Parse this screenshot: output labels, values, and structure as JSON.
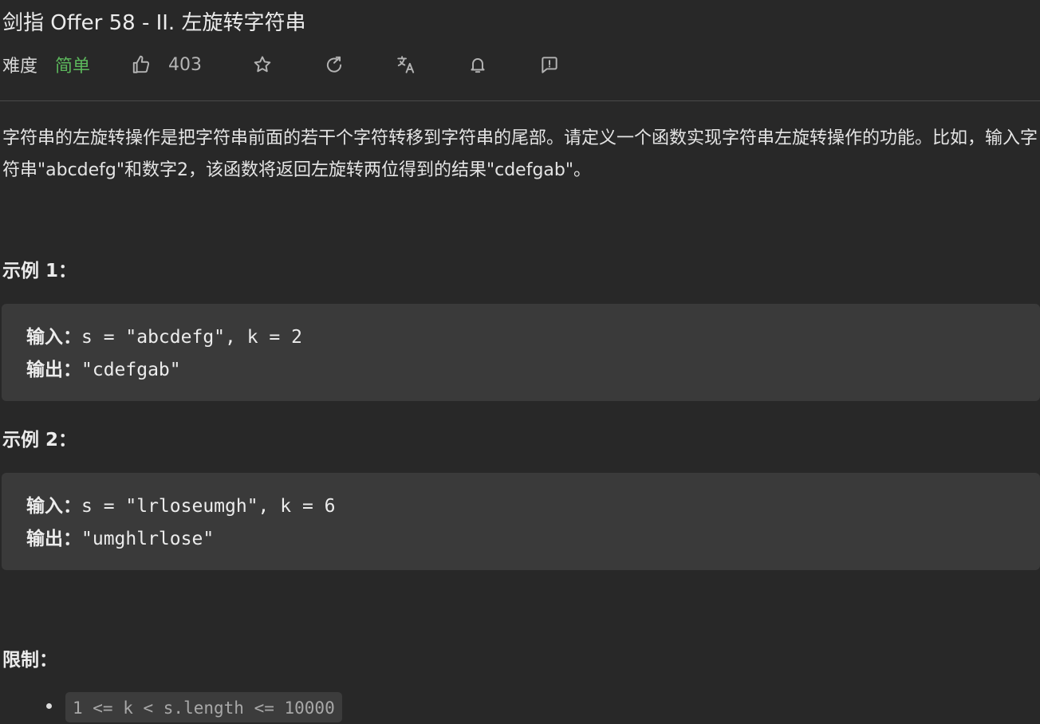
{
  "problem": {
    "title": "剑指 Offer 58 - II. 左旋转字符串",
    "difficulty_label": "难度",
    "difficulty": "简单",
    "likes": "403",
    "description": "字符串的左旋转操作是把字符串前面的若干个字符转移到字符串的尾部。请定义一个函数实现字符串左旋转操作的功能。比如，输入字符串\"abcdefg\"和数字2，该函数将返回左旋转两位得到的结果\"cdefgab\"。"
  },
  "toolbar": {
    "icons": [
      "thumbs-up-icon",
      "star-icon",
      "share-icon",
      "translate-icon",
      "bell-icon",
      "feedback-icon"
    ]
  },
  "examples": [
    {
      "heading": "示例 1：",
      "input_label": "输入：",
      "input": "s = \"abcdefg\", k = 2",
      "output_label": "输出：",
      "output": "\"cdefgab\""
    },
    {
      "heading": "示例 2：",
      "input_label": "输入：",
      "input": "s = \"lrloseumgh\", k = 6",
      "output_label": "输出：",
      "output": "\"umghlrlose\""
    }
  ],
  "constraints": {
    "heading": "限制：",
    "items": [
      "1 <= k < s.length <= 10000"
    ]
  },
  "colors": {
    "background": "#282828",
    "easy": "#5cb85c",
    "code_block": "#3a3a3a"
  }
}
